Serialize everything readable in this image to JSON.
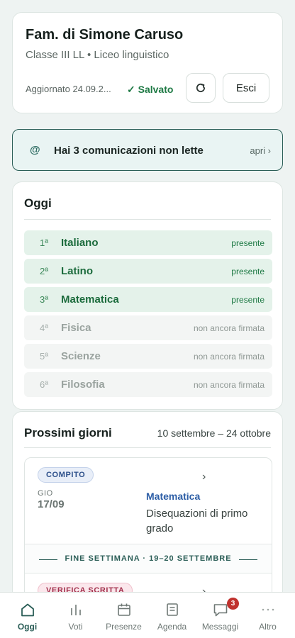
{
  "header": {
    "title": "Fam. di Simone Caruso",
    "subtitle": "Classe III LL • Liceo linguistico",
    "updated": "Aggiornato 24.09.2...",
    "saved": "✓ Salvato",
    "logout_label": "Esci",
    "refresh_icon": "refresh-icon"
  },
  "notice": {
    "icon": "@",
    "text": "Hai 3 comunicazioni non lette",
    "action": "apri ›"
  },
  "today": {
    "title": "Oggi",
    "lessons": [
      {
        "num": "1ª",
        "subject": "Italiano",
        "status": "presente",
        "state": "present"
      },
      {
        "num": "2ª",
        "subject": "Latino",
        "status": "presente",
        "state": "present"
      },
      {
        "num": "3ª",
        "subject": "Matematica",
        "status": "presente",
        "state": "present"
      },
      {
        "num": "4ª",
        "subject": "Fisica",
        "status": "non ancora firmata",
        "state": "pending"
      },
      {
        "num": "5ª",
        "subject": "Scienze",
        "status": "non ancora firmata",
        "state": "pending"
      },
      {
        "num": "6ª",
        "subject": "Filosofia",
        "status": "non ancora firmata",
        "state": "pending"
      }
    ]
  },
  "upcoming": {
    "title": "Prossimi giorni",
    "range": "10 settembre – 24 ottobre",
    "events": [
      {
        "badge": "COMPITO",
        "dow": "GIO",
        "date": "17/09",
        "subject": "Matematica",
        "description": "Disequazioni di primo grado"
      },
      {
        "badge": "VERIFICA SCRITTA"
      }
    ],
    "weekend_label": "FINE SETTIMANA · 19–20 SETTEMBRE",
    "chevron": "›"
  },
  "nav": {
    "items": [
      {
        "label": "Oggi",
        "icon": "home-icon",
        "active": true
      },
      {
        "label": "Voti",
        "icon": "bar-chart-icon"
      },
      {
        "label": "Presenze",
        "icon": "calendar-icon"
      },
      {
        "label": "Agenda",
        "icon": "notebook-icon"
      },
      {
        "label": "Messaggi",
        "icon": "chat-icon",
        "badge": "3"
      },
      {
        "label": "Altro",
        "icon": "more-icon"
      }
    ]
  },
  "colors": {
    "accent": "#2b5e57",
    "present_bg": "#e4f2ea",
    "present_text": "#1f7a45",
    "subject_link": "#2d5ea6",
    "badge_red": "#c0322e"
  }
}
